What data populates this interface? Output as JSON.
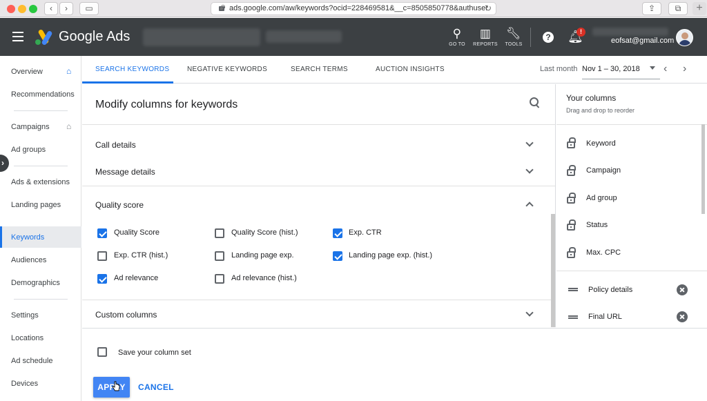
{
  "browser": {
    "url": "ads.google.com/aw/keywords?ocid=228469581&__c=8505850778&authuser"
  },
  "header": {
    "brand": "Google Ads",
    "goto_label": "GO TO",
    "reports_label": "REPORTS",
    "tools_label": "TOOLS",
    "notification_count": "!",
    "email": "eofsat@gmail.com"
  },
  "leftnav": {
    "items": [
      {
        "label": "Overview"
      },
      {
        "label": "Recommendations"
      },
      {
        "label": "Campaigns"
      },
      {
        "label": "Ad groups"
      },
      {
        "label": "Ads & extensions"
      },
      {
        "label": "Landing pages"
      },
      {
        "label": "Keywords"
      },
      {
        "label": "Audiences"
      },
      {
        "label": "Demographics"
      },
      {
        "label": "Settings"
      },
      {
        "label": "Locations"
      },
      {
        "label": "Ad schedule"
      },
      {
        "label": "Devices"
      }
    ],
    "active": "Keywords"
  },
  "tabs": {
    "items": [
      {
        "label": "SEARCH KEYWORDS"
      },
      {
        "label": "NEGATIVE KEYWORDS"
      },
      {
        "label": "SEARCH TERMS"
      },
      {
        "label": "AUCTION INSIGHTS"
      }
    ],
    "active": "SEARCH KEYWORDS",
    "date_label": "Last month",
    "date_range": "Nov 1 – 30, 2018"
  },
  "panel": {
    "title": "Modify columns for keywords",
    "sections": {
      "call_details": "Call details",
      "message_details": "Message details",
      "quality_score": "Quality score",
      "custom_columns": "Custom columns"
    },
    "checkboxes": [
      {
        "label": "Quality Score",
        "checked": true
      },
      {
        "label": "Quality Score (hist.)",
        "checked": false
      },
      {
        "label": "Exp. CTR",
        "checked": true
      },
      {
        "label": "Exp. CTR (hist.)",
        "checked": false
      },
      {
        "label": "Landing page exp.",
        "checked": false
      },
      {
        "label": "Landing page exp. (hist.)",
        "checked": true
      },
      {
        "label": "Ad relevance",
        "checked": true
      },
      {
        "label": "Ad relevance (hist.)",
        "checked": false
      }
    ]
  },
  "your_columns": {
    "title": "Your columns",
    "subtitle": "Drag and drop to reorder",
    "locked": [
      {
        "label": "Keyword"
      },
      {
        "label": "Campaign"
      },
      {
        "label": "Ad group"
      },
      {
        "label": "Status"
      },
      {
        "label": "Max. CPC"
      }
    ],
    "removable": [
      {
        "label": "Policy details"
      },
      {
        "label": "Final URL"
      }
    ]
  },
  "footer": {
    "save_label": "Save your column set",
    "save_checked": false,
    "apply_label": "APPLY",
    "cancel_label": "CANCEL"
  },
  "colors": {
    "accent": "#1a73e8",
    "header_bg": "#3c4043",
    "apply_bg": "#4285f4"
  }
}
